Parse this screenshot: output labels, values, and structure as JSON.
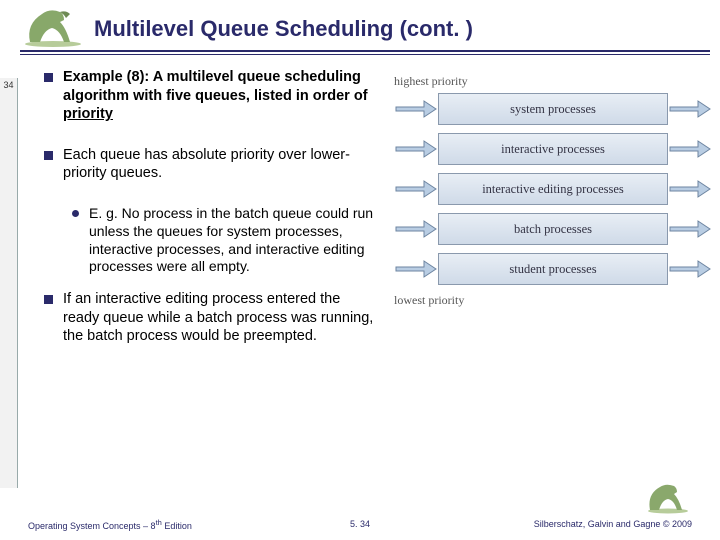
{
  "header": {
    "title": "Multilevel Queue Scheduling (cont. )"
  },
  "page_tab": "34",
  "bullets": {
    "example": {
      "prefix": "Example (8): ",
      "rest_a": "A multilevel queue scheduling algorithm with five queues, listed in order of ",
      "priority_word": "priority"
    },
    "absolute": "Each queue has absolute priority over lower-priority queues.",
    "eg": "E. g. No process in the batch queue could run unless the queues for system processes, interactive processes, and interactive editing processes were all empty.",
    "preempt": "If an interactive editing process entered the ready queue while a batch process was running, the batch process would be preempted."
  },
  "diagram": {
    "highest": "highest priority",
    "lowest": "lowest priority",
    "queues": [
      "system processes",
      "interactive processes",
      "interactive editing processes",
      "batch processes",
      "student processes"
    ]
  },
  "footer": {
    "left": "Operating System Concepts – 8",
    "left_sup": "th",
    "left_tail": " Edition",
    "mid": "5. 34",
    "right_a": "Silberschatz, Galvin and Gagne ",
    "right_b": "© 2009"
  }
}
